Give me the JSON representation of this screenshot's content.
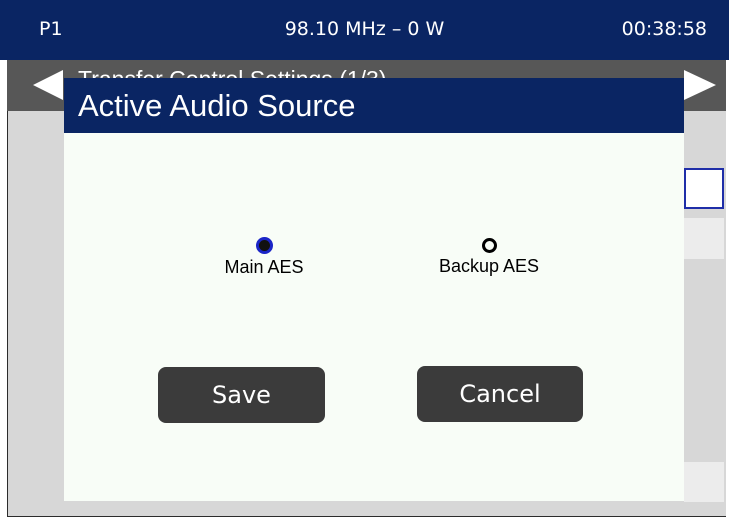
{
  "status_bar": {
    "page": "P1",
    "frequency_power": "98.10 MHz – 0 W",
    "clock": "00:38:58"
  },
  "background_screen": {
    "title": "Transfer Control Settings (1/3)"
  },
  "dialog": {
    "title": "Active Audio Source",
    "options": [
      {
        "label": "Main AES",
        "selected": true
      },
      {
        "label": "Backup AES",
        "selected": false
      }
    ],
    "save_label": "Save",
    "cancel_label": "Cancel"
  },
  "colors": {
    "header_navy": "#0a2563",
    "dialog_background": "#f8fdf7",
    "button_dark": "#3b3b3b",
    "radio_selected_ring": "#1b25c7"
  }
}
